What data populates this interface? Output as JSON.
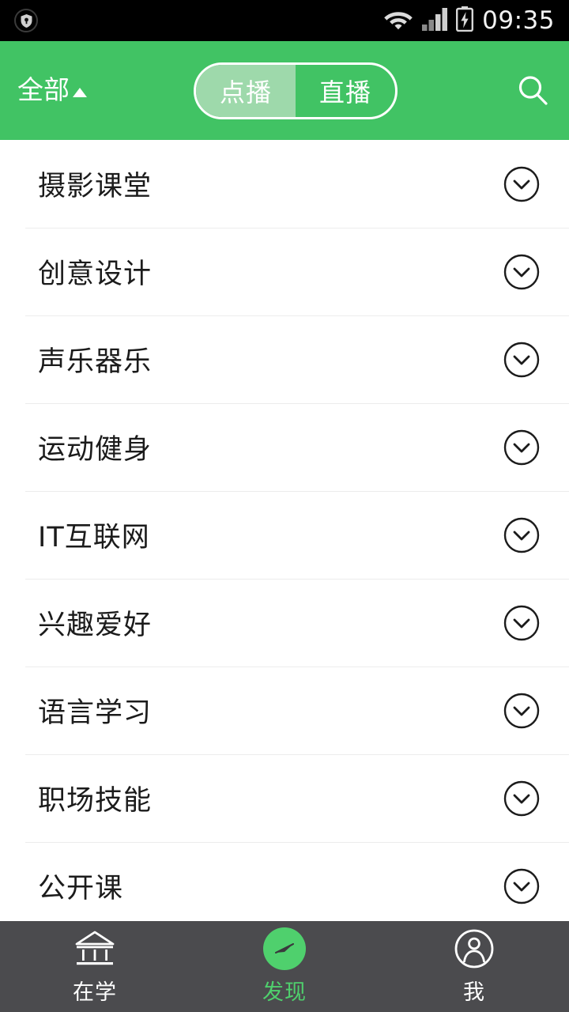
{
  "status_bar": {
    "left_icon": "shield-security-icon",
    "wifi_icon": "wifi-icon",
    "signal_icon": "signal-bars-icon",
    "battery_icon": "battery-charging-icon",
    "time": "09:35"
  },
  "header": {
    "filter_label": "全部",
    "filter_caret": "caret-up-icon",
    "segmented": {
      "options": [
        {
          "label": "点播",
          "selected": true
        },
        {
          "label": "直播",
          "selected": false
        }
      ]
    },
    "search_icon": "search-icon",
    "background_color": "#41c364",
    "selected_segment_color": "#9ed9ab"
  },
  "category_list": {
    "expand_icon": "chevron-down-circle-icon",
    "items": [
      {
        "label": "摄影课堂"
      },
      {
        "label": "创意设计"
      },
      {
        "label": "声乐器乐"
      },
      {
        "label": "运动健身"
      },
      {
        "label": "IT互联网"
      },
      {
        "label": "兴趣爱好"
      },
      {
        "label": "语言学习"
      },
      {
        "label": "职场技能"
      },
      {
        "label": "公开课"
      }
    ]
  },
  "tab_bar": {
    "background_color": "#4b4b4e",
    "active_color": "#4fd06d",
    "tabs": [
      {
        "label": "在学",
        "icon": "bank-building-icon",
        "active": false
      },
      {
        "label": "发现",
        "icon": "compass-icon",
        "active": true
      },
      {
        "label": "我",
        "icon": "person-circle-icon",
        "active": false
      }
    ]
  }
}
